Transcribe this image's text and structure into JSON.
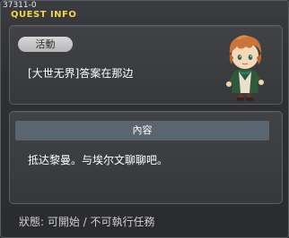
{
  "quest": {
    "id": "37311-0",
    "header_title": "QUEST INFO",
    "activity_tag": "活動",
    "name": "[大世无界]答案在那边",
    "content_header": "內容",
    "content_text": "抵达黎曼。与埃尔文聊聊吧。",
    "status": "狀態: 可開始 / 不可執行任務"
  },
  "colors": {
    "header_title": "#f2d64a",
    "panel_bg": "#3a3c40",
    "section_header_bg": "#596670",
    "tag_bg": "#c8c8c8"
  }
}
